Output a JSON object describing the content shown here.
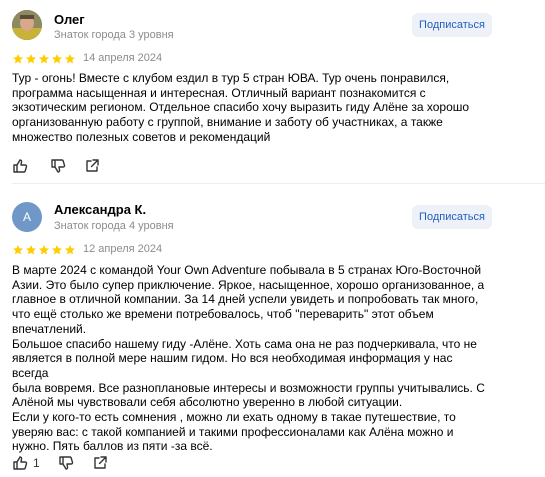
{
  "reviews": [
    {
      "author": "Олег",
      "level": "Знаток города 3 уровня",
      "subscribe_label": "Подписаться",
      "rating": 5,
      "date": "14 апреля 2024",
      "text": "Тур - огонь! Вместе с клубом ездил в тур 5 стран ЮВА. Тур очень понравился,\nпрограмма насыщенная и интересная. Отличный вариант познакомится с\nэкзотическим регионом. Отдельное спасибо хочу выразить гиду Алёне за хорошо\nорганизованную работу с группой, внимание и заботу об участниках, а также\nмножество полезных советов и рекомендаций",
      "likes": ""
    },
    {
      "author": "Александра К.",
      "avatar_letter": "А",
      "level": "Знаток города 4 уровня",
      "subscribe_label": "Подписаться",
      "rating": 5,
      "date": "12 апреля 2024",
      "text": "В марте 2024 с командой Your Own Adventure побывала в 5 странах Юго-Восточной\nАзии. Это было супер приключение. Яркое, насыщенное, хорошо организованное, а\nглавное в отличной компании. За 14 дней успели увидеть и попробовать так много,\nчто ещё столько же времени потребовалось, чтоб \"переварить\" этот объем\nвпечатлений.\nБольшое спасибо нашему гиду -Алёне. Хоть сама она не раз подчеркивала, что не\nявляется в полной мере нашим гидом. Но вся необходимая информация у нас всегда\nбыла вовремя. Все разноплановые интересы и возможности группы учитывались. С\nАлёной мы чувствовали себя абсолютно уверенно в любой ситуации.\nЕсли у кого-то есть сомнения , можно ли ехать одному в такае путешествие, то\nуверяю вас: с такой компанией и такими профессионалами как Алёна можно и\nнужно. Пять баллов из пяти -за всё.",
      "likes": "1"
    }
  ],
  "colors": {
    "star": "#ffcc00",
    "subscribe_text": "#1f5fbf",
    "subscribe_bg": "#eef1f7"
  },
  "icons": {
    "like": "thumb-up-icon",
    "dislike": "thumb-down-icon",
    "share": "share-icon"
  }
}
